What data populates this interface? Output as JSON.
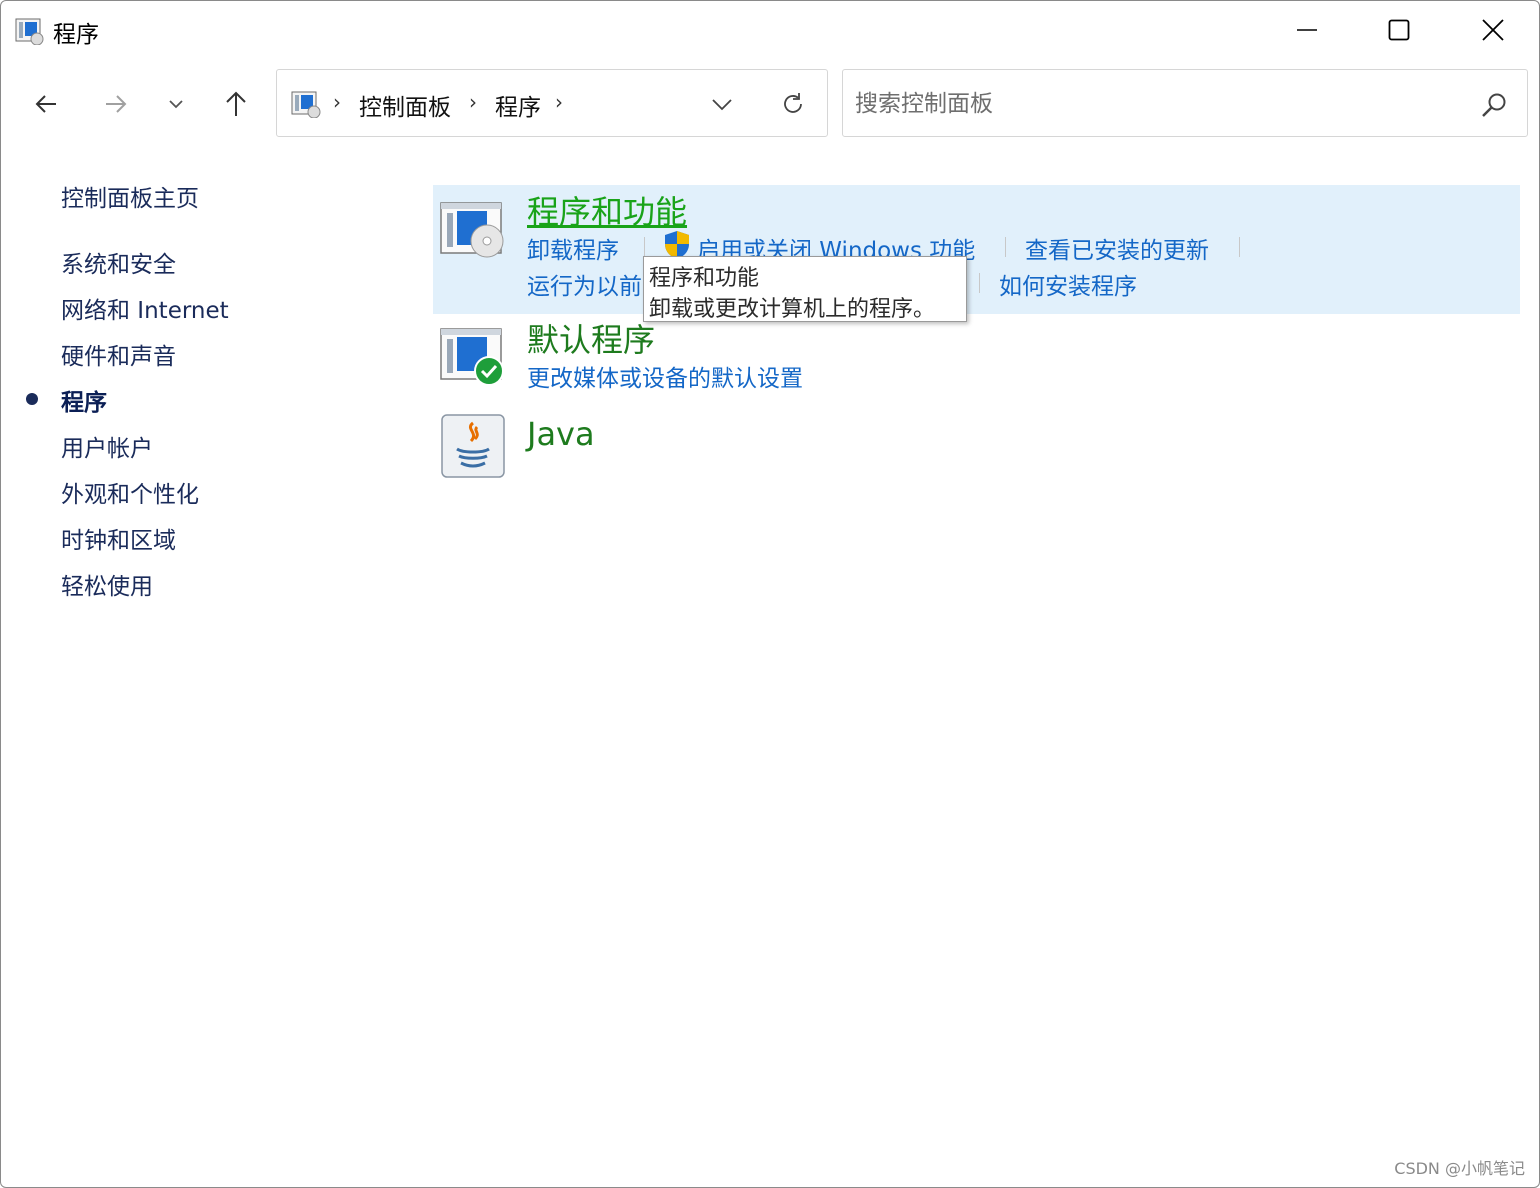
{
  "window": {
    "title": "程序",
    "icon": "control-panel-icon",
    "controls": {
      "minimize": "minimize-icon",
      "maximize": "maximize-icon",
      "close": "close-icon"
    }
  },
  "nav": {
    "back": "arrow-left-icon",
    "forward": "arrow-right-icon",
    "recent": "chevron-down-icon",
    "up": "arrow-up-icon"
  },
  "address": {
    "crumbs": [
      "控制面板",
      "程序"
    ],
    "dropdown": "chevron-down-icon",
    "refresh": "refresh-icon"
  },
  "search": {
    "placeholder": "搜索控制面板",
    "value": ""
  },
  "sidebar": {
    "home": "控制面板主页",
    "items": [
      "系统和安全",
      "网络和 Internet",
      "硬件和声音",
      "程序",
      "用户帐户",
      "外观和个性化",
      "时钟和区域",
      "轻松使用"
    ],
    "current": "程序"
  },
  "main": {
    "categories": [
      {
        "title": "程序和功能",
        "icon": "programs-features-icon",
        "links_row1": [
          "卸载程序",
          "启用或关闭 Windows 功能",
          "查看已安装的更新"
        ],
        "links_row2": [
          "运行为以前",
          "如何安装程序"
        ]
      },
      {
        "title": "默认程序",
        "icon": "default-programs-icon",
        "links_row1": [
          "更改媒体或设备的默认设置"
        ]
      },
      {
        "title": "Java",
        "icon": "java-icon"
      }
    ]
  },
  "tooltip": {
    "title": "程序和功能",
    "description": "卸载或更改计算机上的程序。"
  },
  "watermark": "CSDN @小帆笔记",
  "colors": {
    "link": "#1467c7",
    "category_title": "#1e7b1e",
    "highlight": "#e1f0fb"
  }
}
